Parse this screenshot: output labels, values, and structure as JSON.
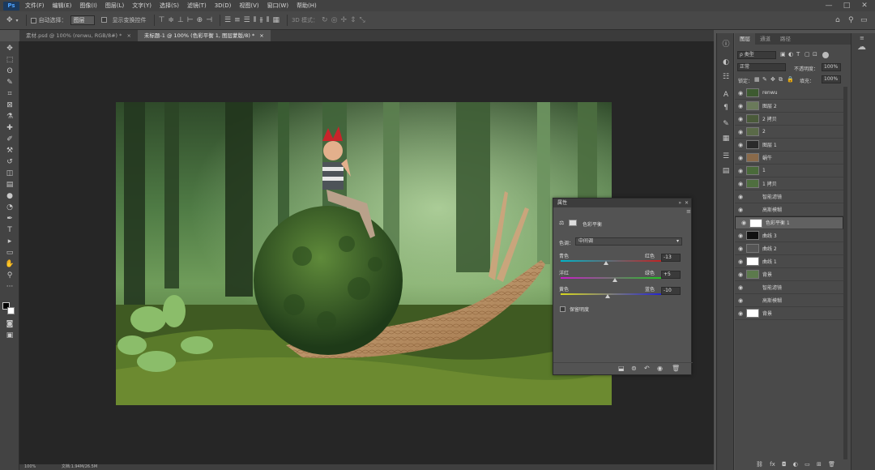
{
  "menu": {
    "logo": "Ps",
    "items": [
      "文件(F)",
      "编辑(E)",
      "图像(I)",
      "图层(L)",
      "文字(Y)",
      "选择(S)",
      "滤镜(T)",
      "3D(D)",
      "视图(V)",
      "窗口(W)",
      "帮助(H)"
    ],
    "window_controls": [
      "—",
      "□",
      "✕"
    ]
  },
  "options": {
    "auto_select_label": "自动选择：",
    "auto_select_value": "图层",
    "show_transform_label": "显示变换控件",
    "mode_3d_label": "3D 模式："
  },
  "tabs": [
    {
      "label": "素材.psd @ 100% (renwu, RGB/8#) *",
      "close": "×",
      "active": false
    },
    {
      "label": "未标题-1 @ 100% (色彩平衡 1, 图层蒙版/8) *",
      "close": "×",
      "active": true
    }
  ],
  "status": {
    "zoom": "100%",
    "doc": "文档:1.94M/26.5M"
  },
  "properties": {
    "title": "属性",
    "subtitle": "色彩平衡",
    "tone_label": "色调：",
    "tone_value": "中间调",
    "sliders": [
      {
        "left": "青色",
        "right": "红色",
        "value": "-13",
        "level": -13,
        "gradient": [
          "#00b4c8",
          "#c81e1e"
        ]
      },
      {
        "left": "洋红",
        "right": "绿色",
        "value": "+5",
        "level": 5,
        "gradient": [
          "#c81ec8",
          "#1ec81e"
        ]
      },
      {
        "left": "黄色",
        "right": "蓝色",
        "value": "-10",
        "level": -10,
        "gradient": [
          "#d8d81e",
          "#1e1ed8"
        ]
      }
    ],
    "preserve_label": "保留明度"
  },
  "layers_panel": {
    "tabs": [
      "图层",
      "通道",
      "路径"
    ],
    "kind_label": "ρ 类型",
    "blend_mode": "正常",
    "opacity_label": "不透明度：",
    "opacity_value": "100%",
    "lock_label": "锁定：",
    "fill_label": "填充：",
    "fill_value": "100%",
    "layers": [
      {
        "name": "renwu",
        "visible": true,
        "selected": false
      },
      {
        "name": "图层 2",
        "visible": true,
        "selected": false
      },
      {
        "name": "2 拷贝",
        "visible": true,
        "selected": false
      },
      {
        "name": "2",
        "visible": true,
        "selected": false
      },
      {
        "name": "图层 1",
        "visible": true,
        "selected": false
      },
      {
        "name": "蜗牛",
        "visible": true,
        "selected": false
      },
      {
        "name": "1",
        "visible": true,
        "selected": false
      },
      {
        "name": "1 拷贝",
        "visible": true,
        "selected": false
      },
      {
        "name": "智能滤镜",
        "visible": true,
        "selected": false,
        "sub": true
      },
      {
        "name": "高斯模糊",
        "visible": true,
        "selected": false,
        "sub": true
      },
      {
        "name": "色彩平衡 1",
        "visible": true,
        "selected": true
      },
      {
        "name": "曲线 3",
        "visible": true,
        "selected": false
      },
      {
        "name": "曲线 2",
        "visible": true,
        "selected": false
      },
      {
        "name": "曲线 1",
        "visible": true,
        "selected": false
      },
      {
        "name": "背景",
        "visible": true,
        "selected": false
      },
      {
        "name": "智能滤镜",
        "visible": true,
        "selected": false,
        "sub": true
      },
      {
        "name": "高斯模糊",
        "visible": true,
        "selected": false,
        "sub": true
      },
      {
        "name": "背景",
        "visible": true,
        "selected": false
      }
    ]
  }
}
